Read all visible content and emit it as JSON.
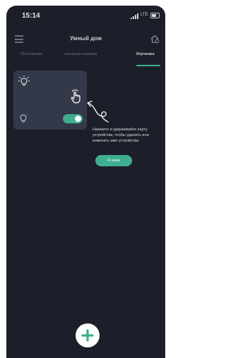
{
  "status_bar": {
    "time": "15:14",
    "network": "LTE"
  },
  "header": {
    "title": "Умный дом"
  },
  "tabs": [
    {
      "label": "Постоянная"
    },
    {
      "label": "спальная комната"
    },
    {
      "label": "Изучение",
      "active": true
    }
  ],
  "device_card": {
    "switch_state": "on"
  },
  "hint": {
    "text": "Нажмите и удерживайте карту устройства, чтобы удалить или изменить имя устройства.",
    "button_label": "Я знаю"
  },
  "colors": {
    "accent": "#3fae8f",
    "background": "#1c1f2a",
    "card": "#343949"
  },
  "icons": [
    "menu-icon",
    "home-gear-icon",
    "lightbulb-icon",
    "tap-hand-icon",
    "curved-arrow-icon",
    "plus-icon"
  ]
}
